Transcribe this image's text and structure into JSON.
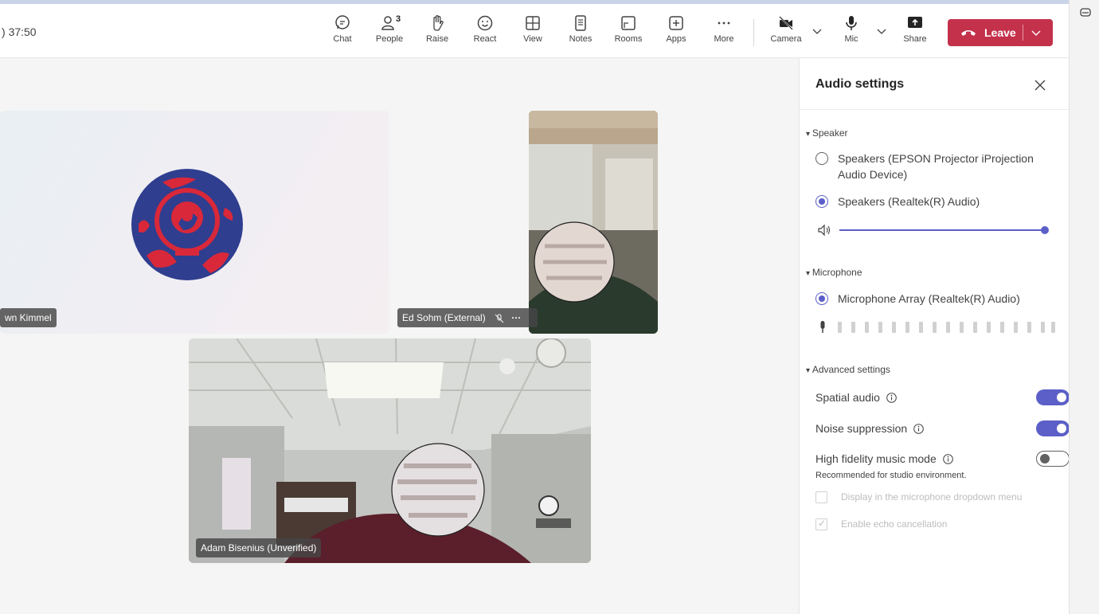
{
  "meeting": {
    "timer": "37:50"
  },
  "toolbar": {
    "chat": "Chat",
    "people": "People",
    "people_count": "3",
    "raise": "Raise",
    "react": "React",
    "view": "View",
    "notes": "Notes",
    "rooms": "Rooms",
    "apps": "Apps",
    "more": "More",
    "camera": "Camera",
    "mic": "Mic",
    "share": "Share",
    "leave": "Leave"
  },
  "participants": {
    "kimmel": "wn Kimmel",
    "ed": "Ed Sohm (External)",
    "adam": "Adam Bisenius (Unverified)"
  },
  "audio_settings": {
    "title": "Audio settings",
    "speaker_section": "Speaker",
    "speaker_options": [
      "Speakers (EPSON Projector iProjection Audio Device)",
      "Speakers (Realtek(R) Audio)"
    ],
    "selected_speaker": 1,
    "speaker_volume_percent": 100,
    "microphone_section": "Microphone",
    "microphone_option": "Microphone Array (Realtek(R) Audio)",
    "advanced_section": "Advanced settings",
    "spatial_audio": "Spatial audio",
    "spatial_audio_on": true,
    "noise_suppression": "Noise suppression",
    "noise_suppression_on": true,
    "high_fidelity": "High fidelity music mode",
    "high_fidelity_on": false,
    "high_fidelity_hint": "Recommended for studio environment.",
    "display_in_dropdown": "Display in the microphone dropdown menu",
    "display_in_dropdown_checked": false,
    "echo_cancellation": "Enable echo cancellation",
    "echo_cancellation_checked": true
  },
  "colors": {
    "accent": "#5b5fc7",
    "leave": "#c4314b"
  }
}
